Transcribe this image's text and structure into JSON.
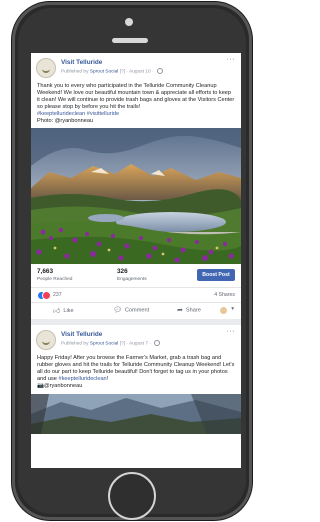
{
  "post1": {
    "page_name": "Visit Telluride",
    "published_prefix": "Published by",
    "publisher": "Sprout Social",
    "publisher_suffix": "[?]",
    "date": "· August 10 ·",
    "body": "Thank you to every who participated in the Telluride Community Cleanup Weekend! We love our beautiful mountain town & appreciate all efforts to keep it clean! We will continue to provide trash bags and gloves at the Visitors Center so please stop by before you hit the trails!",
    "hashtags": "#keeptelluride​clean #visittelluride",
    "photo_credit": "Photo: @ryanbonneau",
    "people_reached_value": "7,663",
    "people_reached_label": "People Reached",
    "engagements_value": "326",
    "engagements_label": "Engagements",
    "boost_label": "Boost Post",
    "reaction_count": "237",
    "shares": "4 Shares",
    "actions": {
      "like": "Like",
      "comment": "Comment",
      "share": "Share"
    }
  },
  "post2": {
    "page_name": "Visit Telluride",
    "published_prefix": "Published by",
    "publisher": "Sprout Social",
    "publisher_suffix": "[?]",
    "date": "· August 7 ·",
    "body": "Happy Friday! After you browse the Farmer's Market, grab a trash bag and rubber gloves and hit the trails for Telluride Community Cleanup Weekend! Let's all do our part to keep Telluride beautiful! Don't forget to tag us in your photos and use",
    "hashtag": "#keeptelluride​clean",
    "body_end": "!",
    "photo_credit": "📷@ryanbonneau"
  },
  "colors": {
    "link": "#385898",
    "boost": "#4267b2",
    "like": "#2078f4",
    "love": "#f33e58"
  },
  "icons": {
    "like": "thumbs-up-icon",
    "comment": "comment-bubble-icon",
    "share": "share-arrow-icon"
  }
}
